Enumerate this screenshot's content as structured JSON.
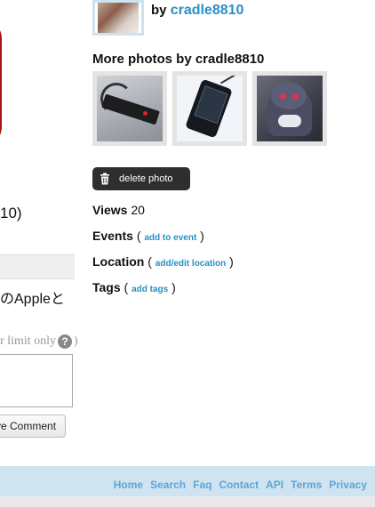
{
  "left": {
    "paren_text": "10)",
    "jp_text": "のAppleと",
    "limit_text": "r limit only",
    "limit_close": ")",
    "help_glyph": "?",
    "save_button_label": "ve Comment"
  },
  "owner": {
    "by_label": "by",
    "username": "cradle8810"
  },
  "more_photos": {
    "title": "More photos by cradle8810",
    "thumbnails": [
      {
        "subject": "cable-device"
      },
      {
        "subject": "solar-charger"
      },
      {
        "subject": "plush-toy"
      }
    ]
  },
  "actions": {
    "delete_label": "delete photo",
    "delete_icon": "trash-icon"
  },
  "meta": {
    "views_label": "Views",
    "views_count": "20",
    "events_label": "Events",
    "events_link": "add to event",
    "location_label": "Location",
    "location_link": "add/edit location",
    "tags_label": "Tags",
    "tags_link": "add tags",
    "open_paren": "(",
    "close_paren": ")"
  },
  "footer": {
    "links": [
      "Home",
      "Search",
      "Faq",
      "Contact",
      "API",
      "Terms",
      "Privacy"
    ]
  },
  "colors": {
    "link": "#2a8fc4",
    "footer_bg": "#cfe3f1",
    "footer_link": "#5aa6d6",
    "button_dark": "#2e2e2e"
  }
}
